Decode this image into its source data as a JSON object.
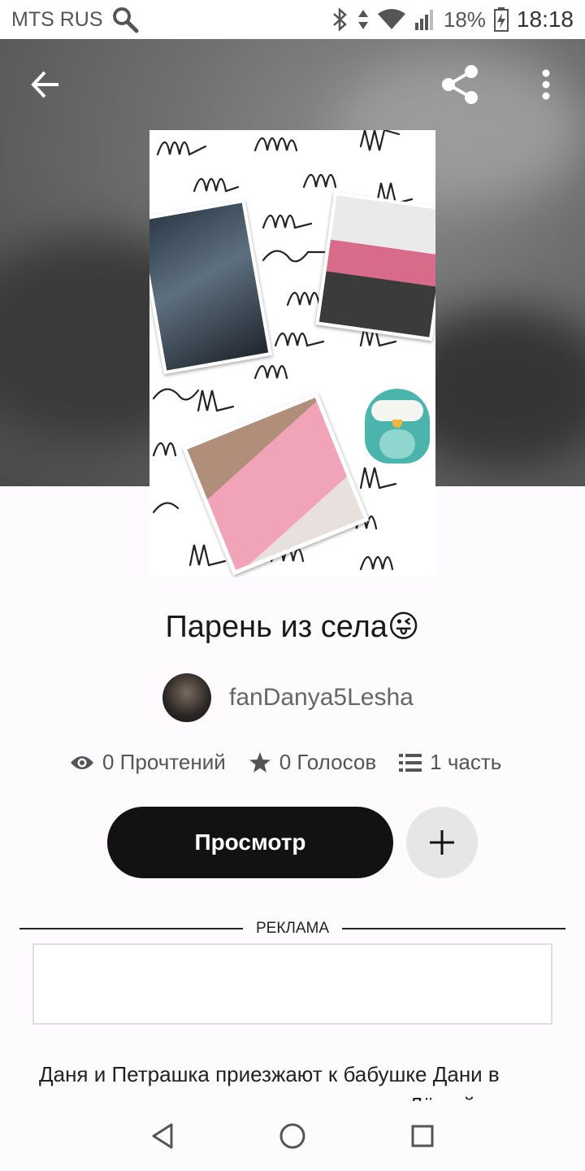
{
  "status_bar": {
    "carrier": "MTS RUS",
    "battery": "18%",
    "time": "18:18"
  },
  "story": {
    "title": "Парень из села😜",
    "author": "fanDanya5Lesha",
    "stats": {
      "reads": "0 Прочтений",
      "votes": "0 Голосов",
      "parts": "1 часть"
    },
    "read_button": "Просмотр",
    "description": "Даня и Петрашка приезжают к бабушке Дани в деревню и знакомятся с новыми ими Лёшей и"
  },
  "ad": {
    "label": "РЕКЛАМА"
  },
  "colors": {
    "primary_button": "#121212",
    "secondary_button": "#e6e6e8",
    "text_muted": "#666666"
  }
}
